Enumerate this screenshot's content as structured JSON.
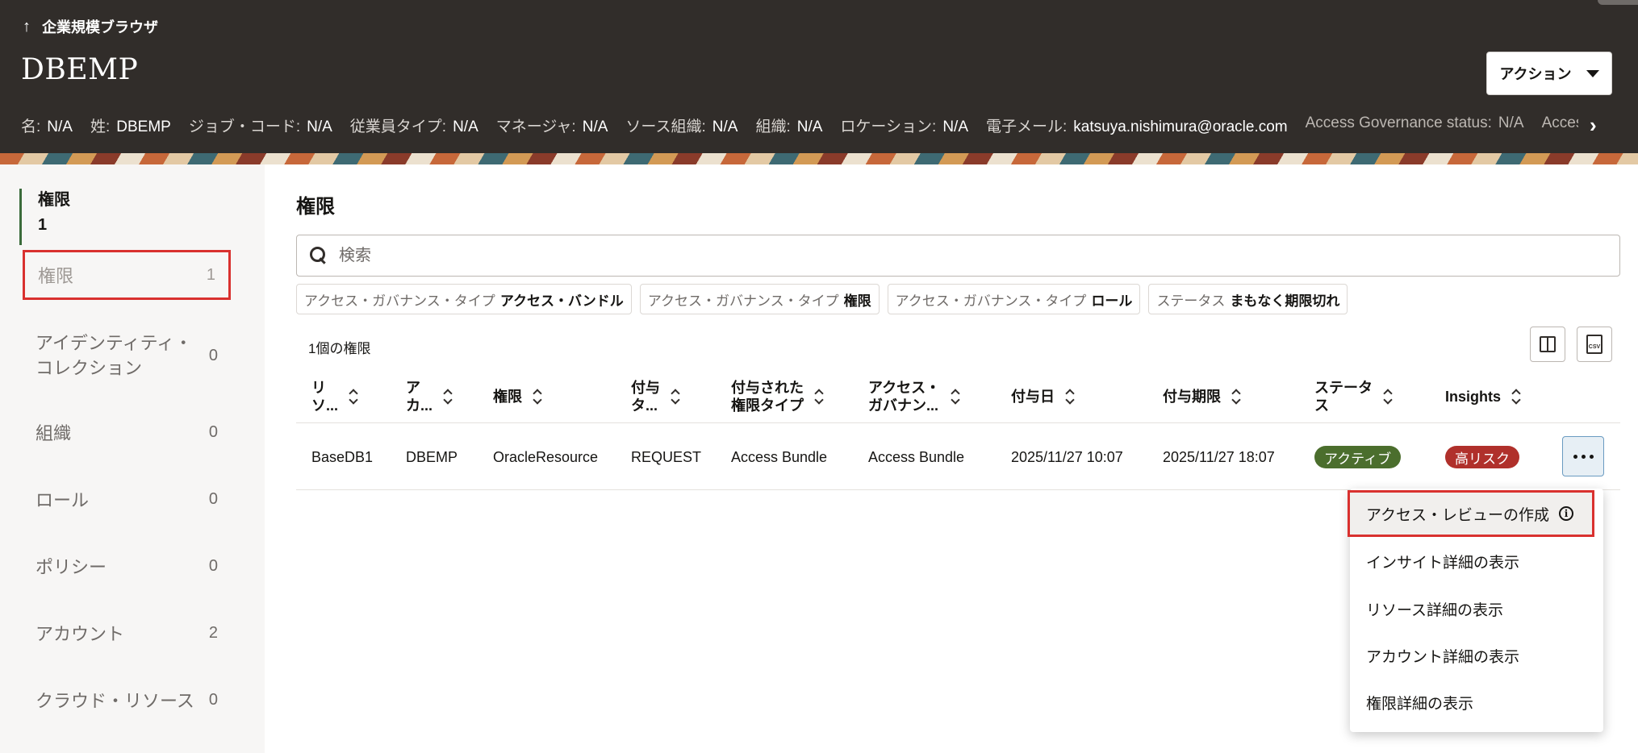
{
  "header": {
    "back_label": "企業規模ブラウザ",
    "title": "DBEMP",
    "action_label": "アクション",
    "info": [
      {
        "key": "名:",
        "value": "N/A"
      },
      {
        "key": "姓:",
        "value": "DBEMP"
      },
      {
        "key": "ジョブ・コード:",
        "value": "N/A"
      },
      {
        "key": "従業員タイプ:",
        "value": "N/A"
      },
      {
        "key": "マネージャ:",
        "value": "N/A"
      },
      {
        "key": "ソース組織:",
        "value": "N/A"
      },
      {
        "key": "組織:",
        "value": "N/A"
      },
      {
        "key": "ロケーション:",
        "value": "N/A"
      },
      {
        "key": "電子メール:",
        "value": "katsuya.nishimura@oracle.com"
      },
      {
        "key": "Access Governance status:",
        "value": "N/A"
      },
      {
        "key": "Access",
        "value": ""
      }
    ]
  },
  "sidenav": {
    "head_title": "権限",
    "head_count": "1",
    "items": [
      {
        "label": "権限",
        "count": "1"
      },
      {
        "label": "アイデンティティ・コレクション",
        "label_line1": "アイデンティティ・",
        "label_line2": "コレクション",
        "count": "0"
      },
      {
        "label": "組織",
        "count": "0"
      },
      {
        "label": "ロール",
        "count": "0"
      },
      {
        "label": "ポリシー",
        "count": "0"
      },
      {
        "label": "アカウント",
        "count": "2"
      },
      {
        "label": "クラウド・リソース",
        "count": "0"
      }
    ]
  },
  "main": {
    "title": "権限",
    "search_placeholder": "検索",
    "filters": [
      {
        "label": "アクセス・ガバナンス・タイプ",
        "value": "アクセス・バンドル"
      },
      {
        "label": "アクセス・ガバナンス・タイプ",
        "value": "権限"
      },
      {
        "label": "アクセス・ガバナンス・タイプ",
        "value": "ロール"
      },
      {
        "label": "ステータス",
        "value": "まもなく期限切れ"
      }
    ],
    "result_count": "1個の権限",
    "csv_label": "CSV"
  },
  "table": {
    "columns": [
      {
        "line1": "リ",
        "line2": "ソ..."
      },
      {
        "line1": "ア",
        "line2": "カ..."
      },
      {
        "line1": "権限",
        "line2": ""
      },
      {
        "line1": "付与",
        "line2": "タ..."
      },
      {
        "line1": "付与された",
        "line2": "権限タイプ"
      },
      {
        "line1": "アクセス・",
        "line2": "ガバナン..."
      },
      {
        "line1": "付与日",
        "line2": ""
      },
      {
        "line1": "付与期限",
        "line2": ""
      },
      {
        "line1": "ステータ",
        "line2": "ス"
      },
      {
        "line1": "Insights",
        "line2": ""
      }
    ],
    "rows": [
      {
        "resource": "BaseDB1",
        "account": "DBEMP",
        "permission": "OracleResource",
        "grant_type": "REQUEST",
        "granted_type": "Access Bundle",
        "governance": "Access Bundle",
        "granted_on": "2025/11/27 10:07",
        "expires_on": "2025/11/27 18:07",
        "status": "アクティブ",
        "insights": "高リスク"
      }
    ]
  },
  "menu": {
    "items": [
      "アクセス・レビューの作成",
      "インサイト詳細の表示",
      "リソース詳細の表示",
      "アカウント詳細の表示",
      "権限詳細の表示"
    ],
    "info_glyph": "i"
  },
  "colors": {
    "header_bg": "#312d2a",
    "active_badge": "#4b6e2d",
    "risk_badge": "#b0302b",
    "highlight_border": "#d9312f"
  }
}
